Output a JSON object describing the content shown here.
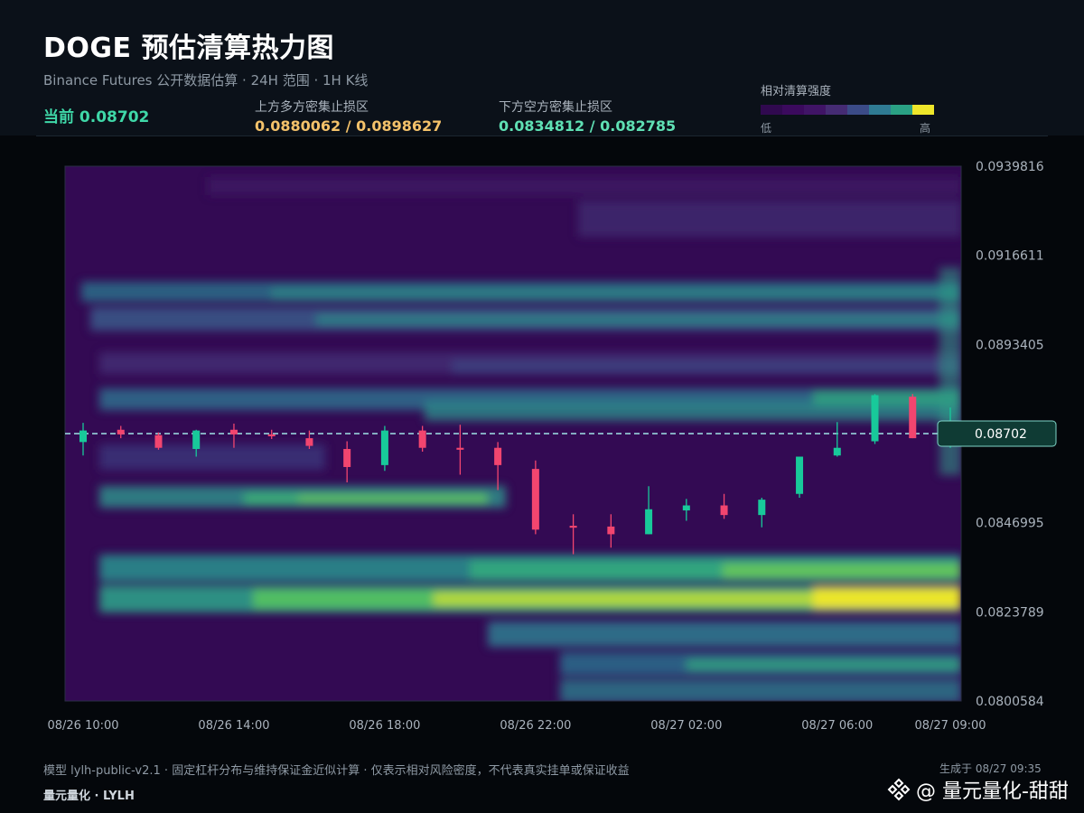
{
  "header": {
    "title": "DOGE 预估清算热力图",
    "subtitle": "Binance Futures 公开数据估算 · 24H 范围 · 1H K线",
    "current_label": "当前 0.08702",
    "zone_up_label": "上方多方密集止损区",
    "zone_up_value": "0.0880062 / 0.0898627",
    "zone_down_label": "下方空方密集止损区",
    "zone_down_value": "0.0834812 / 0.082785"
  },
  "legend": {
    "title": "相对清算强度",
    "low": "低",
    "high": "高",
    "colors": [
      "#30094f",
      "#3b0a5d",
      "#401466",
      "#452b73",
      "#3b4b87",
      "#2f7b93",
      "#2aa184",
      "#eee62a"
    ]
  },
  "chart_data": {
    "type": "heatmap",
    "title": "DOGE 预估清算热力图",
    "x_ticks": [
      "08/26 10:00",
      "08/26 14:00",
      "08/26 18:00",
      "08/26 22:00",
      "08/27 02:00",
      "08/27 06:00",
      "08/27 09:00"
    ],
    "y_ticks": [
      "0.0939816",
      "0.0916611",
      "0.0893405",
      "0.0846995",
      "0.0823789",
      "0.0800584"
    ],
    "ylim": [
      0.0800584,
      0.0939816
    ],
    "current_price": 0.08702,
    "current_price_label": "0.08702",
    "candles": [
      {
        "t": "08/26 10:00",
        "o": 0.0868,
        "h": 0.0873,
        "l": 0.08645,
        "c": 0.0871
      },
      {
        "t": "08/26 11:00",
        "o": 0.08712,
        "h": 0.08722,
        "l": 0.0869,
        "c": 0.087
      },
      {
        "t": "08/26 12:00",
        "o": 0.08698,
        "h": 0.08705,
        "l": 0.0866,
        "c": 0.08665
      },
      {
        "t": "08/26 13:00",
        "o": 0.08662,
        "h": 0.08712,
        "l": 0.08642,
        "c": 0.0871
      },
      {
        "t": "08/26 14:00",
        "o": 0.08712,
        "h": 0.08728,
        "l": 0.08665,
        "c": 0.087
      },
      {
        "t": "08/26 15:00",
        "o": 0.087,
        "h": 0.08712,
        "l": 0.08688,
        "c": 0.08695
      },
      {
        "t": "08/26 16:00",
        "o": 0.0869,
        "h": 0.0871,
        "l": 0.08662,
        "c": 0.0867
      },
      {
        "t": "08/26 17:00",
        "o": 0.08662,
        "h": 0.08682,
        "l": 0.08575,
        "c": 0.08615
      },
      {
        "t": "08/26 18:00",
        "o": 0.0862,
        "h": 0.08722,
        "l": 0.08605,
        "c": 0.0871
      },
      {
        "t": "08/26 19:00",
        "o": 0.0871,
        "h": 0.08722,
        "l": 0.08655,
        "c": 0.08665
      },
      {
        "t": "08/26 20:00",
        "o": 0.08665,
        "h": 0.08725,
        "l": 0.08595,
        "c": 0.0866
      },
      {
        "t": "08/26 21:00",
        "o": 0.08665,
        "h": 0.0868,
        "l": 0.08555,
        "c": 0.0862
      },
      {
        "t": "08/26 22:00",
        "o": 0.0861,
        "h": 0.08632,
        "l": 0.0844,
        "c": 0.08452
      },
      {
        "t": "08/26 23:00",
        "o": 0.08462,
        "h": 0.08492,
        "l": 0.08388,
        "c": 0.08457
      },
      {
        "t": "08/27 00:00",
        "o": 0.0846,
        "h": 0.08492,
        "l": 0.08405,
        "c": 0.0844
      },
      {
        "t": "08/27 01:00",
        "o": 0.0844,
        "h": 0.08565,
        "l": 0.0844,
        "c": 0.08505
      },
      {
        "t": "08/27 02:00",
        "o": 0.08502,
        "h": 0.08532,
        "l": 0.08475,
        "c": 0.08515
      },
      {
        "t": "08/27 03:00",
        "o": 0.08515,
        "h": 0.08545,
        "l": 0.0848,
        "c": 0.0849
      },
      {
        "t": "08/27 04:00",
        "o": 0.0849,
        "h": 0.08535,
        "l": 0.08458,
        "c": 0.0853
      },
      {
        "t": "08/27 05:00",
        "o": 0.08545,
        "h": 0.08642,
        "l": 0.08535,
        "c": 0.08642
      },
      {
        "t": "08/27 06:00",
        "o": 0.08645,
        "h": 0.08732,
        "l": 0.08642,
        "c": 0.08665
      },
      {
        "t": "08/27 07:00",
        "o": 0.08682,
        "h": 0.08805,
        "l": 0.08675,
        "c": 0.08802
      },
      {
        "t": "08/27 08:00",
        "o": 0.08798,
        "h": 0.08805,
        "l": 0.0869,
        "c": 0.0869
      },
      {
        "t": "08/27 09:00",
        "o": 0.08695,
        "h": 0.0877,
        "l": 0.08665,
        "c": 0.08702
      }
    ]
  },
  "footer": {
    "model": "模型 lylh-public-v2.1 · 固定杠杆分布与维持保证金近似计算 · 仅表示相对风险密度，不代表真实挂单或保证收益",
    "brand": "量元量化 · LYLH",
    "generated": "生成于 08/27 09:35",
    "watermark": "@ 量元量化-甜甜"
  }
}
